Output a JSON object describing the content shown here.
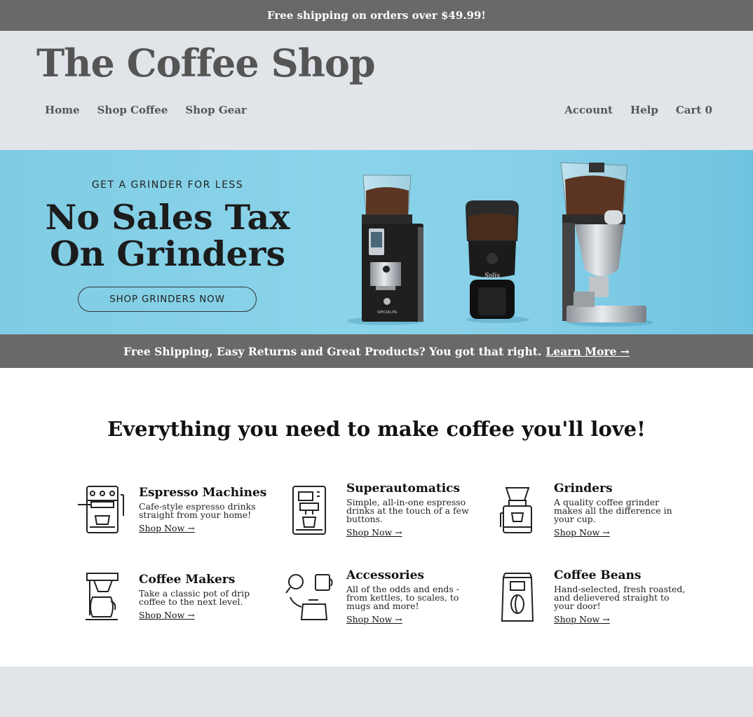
{
  "topbar": {
    "text": "Free shipping on orders over $49.99!"
  },
  "header": {
    "logo": "The Coffee Shop",
    "nav_left": [
      {
        "label": "Home"
      },
      {
        "label": "Shop Coffee"
      },
      {
        "label": "Shop Gear"
      }
    ],
    "nav_right": [
      {
        "label": "Account"
      },
      {
        "label": "Help"
      },
      {
        "label": "Cart 0"
      }
    ]
  },
  "hero": {
    "eyebrow": "GET A GRINDER FOR LESS",
    "title_line1": "No Sales Tax",
    "title_line2": "On Grinders",
    "button": "SHOP GRINDERS NOW",
    "grinder_badge_1": "SPECIALITA",
    "grinder_badge_2": "Solis",
    "background_color": "#86cfe8"
  },
  "promo": {
    "text": "Free Shipping, Easy Returns and Great Products? You got that right.",
    "link": "Learn More →"
  },
  "main": {
    "title": "Everything you need to make coffee you'll love!",
    "categories": [
      {
        "name": "Espresso Machines",
        "desc": "Cafe-style espresso drinks straight from your home!",
        "link": "Shop Now →",
        "icon": "espresso-machine-icon"
      },
      {
        "name": "Superautomatics",
        "desc": "Simple, all-in-one espresso drinks at the touch of a few buttons.",
        "link": "Shop Now →",
        "icon": "superautomatic-icon"
      },
      {
        "name": "Grinders",
        "desc": "A quality coffee grinder makes all the difference in your cup.",
        "link": "Shop Now →",
        "icon": "grinder-icon"
      },
      {
        "name": "Coffee Makers",
        "desc": "Take a classic pot of drip coffee to the next level.",
        "link": "Shop Now →",
        "icon": "coffee-maker-icon"
      },
      {
        "name": "Accessories",
        "desc": "All of the odds and ends - from kettles, to scales, to mugs and more!",
        "link": "Shop Now →",
        "icon": "accessories-icon"
      },
      {
        "name": "Coffee Beans",
        "desc": "Hand-selected, fresh roasted, and delievered straight to your door!",
        "link": "Shop Now →",
        "icon": "coffee-bag-icon"
      }
    ]
  }
}
